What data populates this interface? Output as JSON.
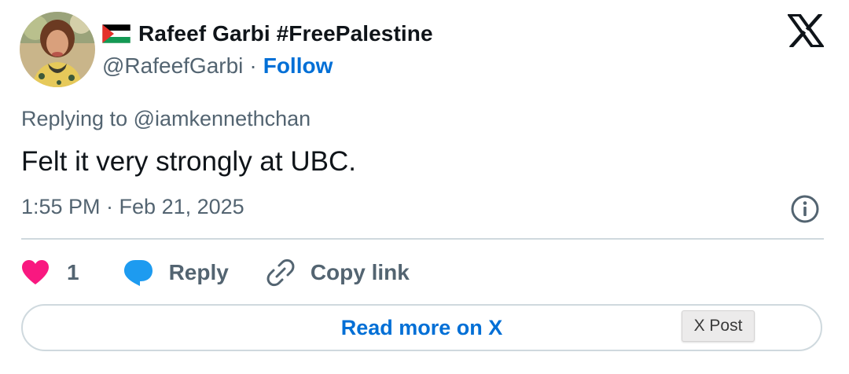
{
  "author": {
    "display_name": "Rafeef Garbi #FreePalestine",
    "handle": "@RafeefGarbi",
    "separator": "·",
    "follow_label": "Follow",
    "flag_icon": "palestine-flag-icon"
  },
  "tweet": {
    "replying_prefix": "Replying to",
    "replying_handle": "@iamkennethchan",
    "text": "Felt it very strongly at UBC.",
    "timestamp": "1:55 PM · Feb 21, 2025"
  },
  "actions": {
    "like_count": "1",
    "reply_label": "Reply",
    "copy_link_label": "Copy link"
  },
  "footer": {
    "read_more_label": "Read more on X",
    "tooltip": "X Post"
  },
  "colors": {
    "link_blue": "#006fd6",
    "muted_text": "#536471",
    "heart_pink": "#f91880",
    "reply_blue": "#1d9bf0",
    "divider": "#cfd9de"
  },
  "icons": [
    "avatar",
    "palestine-flag-icon",
    "x-logo-icon",
    "info-icon",
    "heart-icon",
    "reply-bubble-icon",
    "link-icon"
  ]
}
